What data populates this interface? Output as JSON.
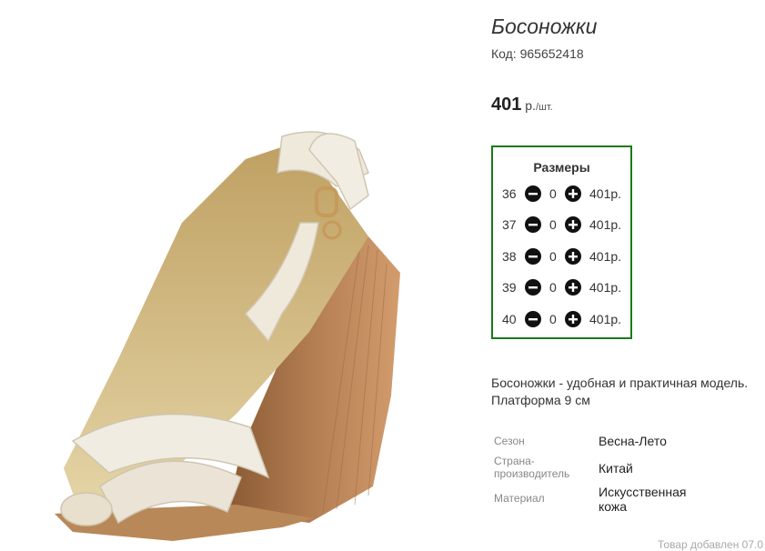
{
  "product": {
    "title": "Босоножки",
    "code_label": "Код: 965652418",
    "price_amount": "401",
    "price_currency": "р.",
    "price_unit": "/шт."
  },
  "sizes": {
    "title": "Размеры",
    "rows": [
      {
        "size": "36",
        "qty": "0",
        "price": "401р."
      },
      {
        "size": "37",
        "qty": "0",
        "price": "401р."
      },
      {
        "size": "38",
        "qty": "0",
        "price": "401р."
      },
      {
        "size": "39",
        "qty": "0",
        "price": "401р."
      },
      {
        "size": "40",
        "qty": "0",
        "price": "401р."
      }
    ],
    "minus_icon": "minus-circle-icon",
    "plus_icon": "plus-circle-icon",
    "border_color": "#1a7a1a"
  },
  "description": "Босоножки - удобная и практичная модель. Платформа 9 см",
  "specs": [
    {
      "key": "Сезон",
      "value": "Весна-Лето"
    },
    {
      "key": "Страна-производитель",
      "value": "Китай"
    },
    {
      "key": "Материал",
      "value": "Искусственная кожа"
    }
  ],
  "footer_note": "Товар добавлен 07.0"
}
